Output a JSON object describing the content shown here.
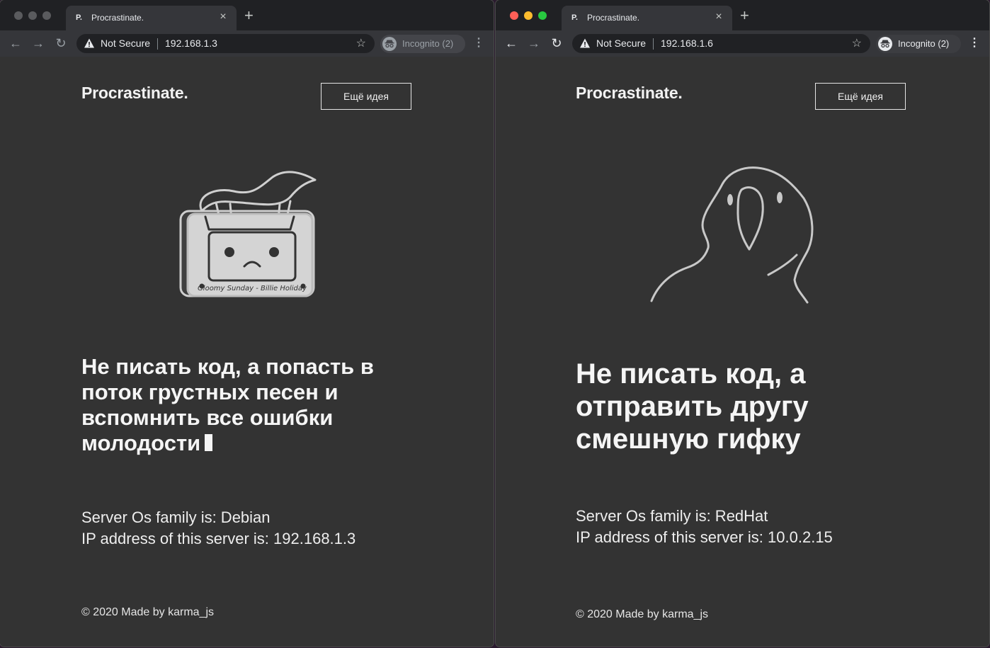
{
  "windows": [
    {
      "tab_favicon": "P.",
      "tab_title": "Procrastinate.",
      "security_label": "Not Secure",
      "url": "192.168.1.3",
      "incognito_label": "Incognito (2)",
      "logo": "Procrastinate.",
      "idea_button": "Ещё идея",
      "cassette_label": "Gloomy Sunday - Billie Holiday",
      "headline": "Не писать код, а попасть в поток грустных песен и вспомнить все ошибки молодости",
      "os_line": "Server Os family is: Debian",
      "ip_line": "IP address of this server is: 192.168.1.3",
      "footer": "© 2020 Made by karma_js"
    },
    {
      "tab_favicon": "P.",
      "tab_title": "Procrastinate.",
      "security_label": "Not Secure",
      "url": "192.168.1.6",
      "incognito_label": "Incognito (2)",
      "logo": "Procrastinate.",
      "idea_button": "Ещё идея",
      "headline": "Не писать код, а отправить другу смешную гифку",
      "os_line": "Server Os family is: RedHat",
      "ip_line": "IP address of this server is: 10.0.2.15",
      "footer": "© 2020 Made by karma_js"
    }
  ],
  "icons": {
    "close": "×",
    "new_tab": "+",
    "back": "←",
    "forward": "→",
    "reload": "↻",
    "star": "☆",
    "kebab": "⋮"
  }
}
